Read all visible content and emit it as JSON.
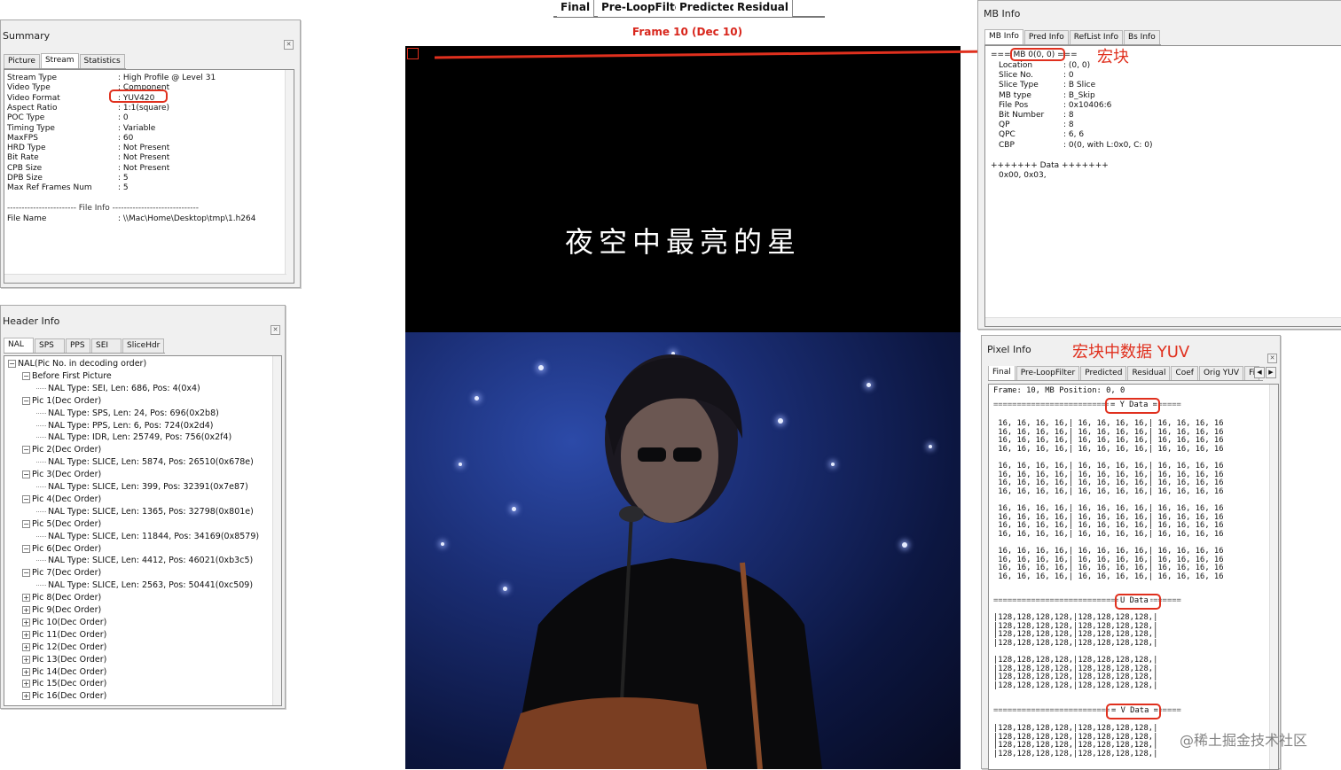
{
  "top_tabs": [
    "Final",
    "Pre-LoopFilter",
    "Predicted",
    "Residual"
  ],
  "frame_label": "Frame 10 (Dec 10)",
  "video": {
    "subtitle": "夜空中最亮的星"
  },
  "summary": {
    "title": "Summary",
    "tabs": [
      "Picture",
      "Stream",
      "Statistics"
    ],
    "rows": [
      {
        "k": "Stream Type",
        "v": ": High Profile @ Level 31"
      },
      {
        "k": "Video Type",
        "v": ": Component"
      },
      {
        "k": "Video Format",
        "v": ": YUV420"
      },
      {
        "k": "Aspect Ratio",
        "v": ": 1:1(square)"
      },
      {
        "k": "POC Type",
        "v": ": 0"
      },
      {
        "k": "Timing Type",
        "v": ": Variable"
      },
      {
        "k": "MaxFPS",
        "v": ": 60"
      },
      {
        "k": "HRD Type",
        "v": ": Not Present"
      },
      {
        "k": "Bit Rate",
        "v": ": Not Present"
      },
      {
        "k": "CPB Size",
        "v": ": Not Present"
      },
      {
        "k": "DPB Size",
        "v": ": 5"
      },
      {
        "k": "Max Ref Frames Num",
        "v": ": 5"
      }
    ],
    "file_info_header": "------------------------ File Info ------------------------------",
    "file_name_key": "File Name",
    "file_name_val": ": \\\\Mac\\Home\\Desktop\\tmp\\1.h264"
  },
  "header_info": {
    "title": "Header Info",
    "tabs": [
      "NAL",
      "SPS",
      "PPS",
      "SEI",
      "SliceHdr"
    ],
    "tree": [
      {
        "lvl": 0,
        "exp": "−",
        "t": "NAL(Pic No. in decoding order)"
      },
      {
        "lvl": 1,
        "exp": "−",
        "t": "Before First Picture"
      },
      {
        "lvl": 2,
        "exp": "",
        "t": "NAL Type: SEI, Len: 686, Pos: 4(0x4)"
      },
      {
        "lvl": 1,
        "exp": "−",
        "t": "Pic 1(Dec Order)"
      },
      {
        "lvl": 2,
        "exp": "",
        "t": "NAL Type: SPS, Len: 24, Pos: 696(0x2b8)"
      },
      {
        "lvl": 2,
        "exp": "",
        "t": "NAL Type: PPS, Len: 6, Pos: 724(0x2d4)"
      },
      {
        "lvl": 2,
        "exp": "",
        "t": "NAL Type: IDR, Len: 25749, Pos: 756(0x2f4)"
      },
      {
        "lvl": 1,
        "exp": "−",
        "t": "Pic 2(Dec Order)"
      },
      {
        "lvl": 2,
        "exp": "",
        "t": "NAL Type: SLICE, Len: 5874, Pos: 26510(0x678e)"
      },
      {
        "lvl": 1,
        "exp": "−",
        "t": "Pic 3(Dec Order)"
      },
      {
        "lvl": 2,
        "exp": "",
        "t": "NAL Type: SLICE, Len: 399, Pos: 32391(0x7e87)"
      },
      {
        "lvl": 1,
        "exp": "−",
        "t": "Pic 4(Dec Order)"
      },
      {
        "lvl": 2,
        "exp": "",
        "t": "NAL Type: SLICE, Len: 1365, Pos: 32798(0x801e)"
      },
      {
        "lvl": 1,
        "exp": "−",
        "t": "Pic 5(Dec Order)"
      },
      {
        "lvl": 2,
        "exp": "",
        "t": "NAL Type: SLICE, Len: 11844, Pos: 34169(0x8579)"
      },
      {
        "lvl": 1,
        "exp": "−",
        "t": "Pic 6(Dec Order)"
      },
      {
        "lvl": 2,
        "exp": "",
        "t": "NAL Type: SLICE, Len: 4412, Pos: 46021(0xb3c5)"
      },
      {
        "lvl": 1,
        "exp": "−",
        "t": "Pic 7(Dec Order)"
      },
      {
        "lvl": 2,
        "exp": "",
        "t": "NAL Type: SLICE, Len: 2563, Pos: 50441(0xc509)"
      },
      {
        "lvl": 1,
        "exp": "+",
        "t": "Pic 8(Dec Order)"
      },
      {
        "lvl": 1,
        "exp": "+",
        "t": "Pic 9(Dec Order)"
      },
      {
        "lvl": 1,
        "exp": "+",
        "t": "Pic 10(Dec Order)"
      },
      {
        "lvl": 1,
        "exp": "+",
        "t": "Pic 11(Dec Order)"
      },
      {
        "lvl": 1,
        "exp": "+",
        "t": "Pic 12(Dec Order)"
      },
      {
        "lvl": 1,
        "exp": "+",
        "t": "Pic 13(Dec Order)"
      },
      {
        "lvl": 1,
        "exp": "+",
        "t": "Pic 14(Dec Order)"
      },
      {
        "lvl": 1,
        "exp": "+",
        "t": "Pic 15(Dec Order)"
      },
      {
        "lvl": 1,
        "exp": "+",
        "t": "Pic 16(Dec Order)"
      }
    ]
  },
  "mb_info": {
    "title": "MB Info",
    "tabs": [
      "MB Info",
      "Pred Info",
      "RefList Info",
      "Bs Info"
    ],
    "header": "=== MB 0(0, 0) ===",
    "rows": [
      {
        "k": "Location",
        "v": ": (0, 0)"
      },
      {
        "k": "Slice No.",
        "v": ": 0"
      },
      {
        "k": "Slice Type",
        "v": ": B Slice"
      },
      {
        "k": "MB type",
        "v": ": B_Skip"
      },
      {
        "k": "File Pos",
        "v": ": 0x10406:6"
      },
      {
        "k": "Bit Number",
        "v": ": 8"
      },
      {
        "k": "QP",
        "v": ": 8"
      },
      {
        "k": "QPC",
        "v": ": 6, 6"
      },
      {
        "k": "CBP",
        "v": ": 0(0, with L:0x0, C: 0)"
      }
    ],
    "data_header": "+++++++ Data +++++++",
    "data_val": "0x00, 0x03,"
  },
  "pixel_info": {
    "title": "Pixel Info",
    "tabs": [
      "Final",
      "Pre-LoopFilter",
      "Predicted",
      "Residual",
      "Coef",
      "Orig YUV",
      "Fi"
    ],
    "frame_line": "Frame: 10, MB Position: 0, 0",
    "y_label": "= Y Data =",
    "u_label": "U Data",
    "v_label": "= V Data =",
    "y_row": " 16, 16, 16, 16,| 16, 16, 16, 16,| 16, 16, 16, 16",
    "uv_row": "|128,128,128,128,|128,128,128,128,|"
  },
  "annotations": {
    "mb": "宏块",
    "pixel": "宏块中数据 YUV"
  },
  "watermark": "@稀土掘金技术社区"
}
